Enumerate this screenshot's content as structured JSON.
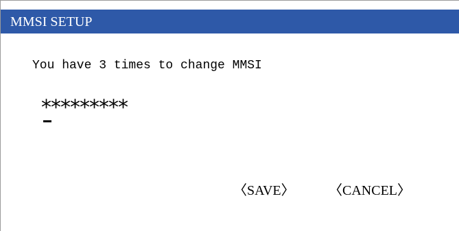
{
  "title": "MMSI SETUP",
  "message": "You have 3 times to change MMSI",
  "mmsi_field": {
    "value": "*********"
  },
  "actions": {
    "save_label": "〈SAVE〉",
    "cancel_label": "〈CANCEL〉"
  },
  "colors": {
    "title_bar": "#2e59a8",
    "title_text": "#ffffff",
    "background": "#ffffff",
    "text": "#000000"
  }
}
